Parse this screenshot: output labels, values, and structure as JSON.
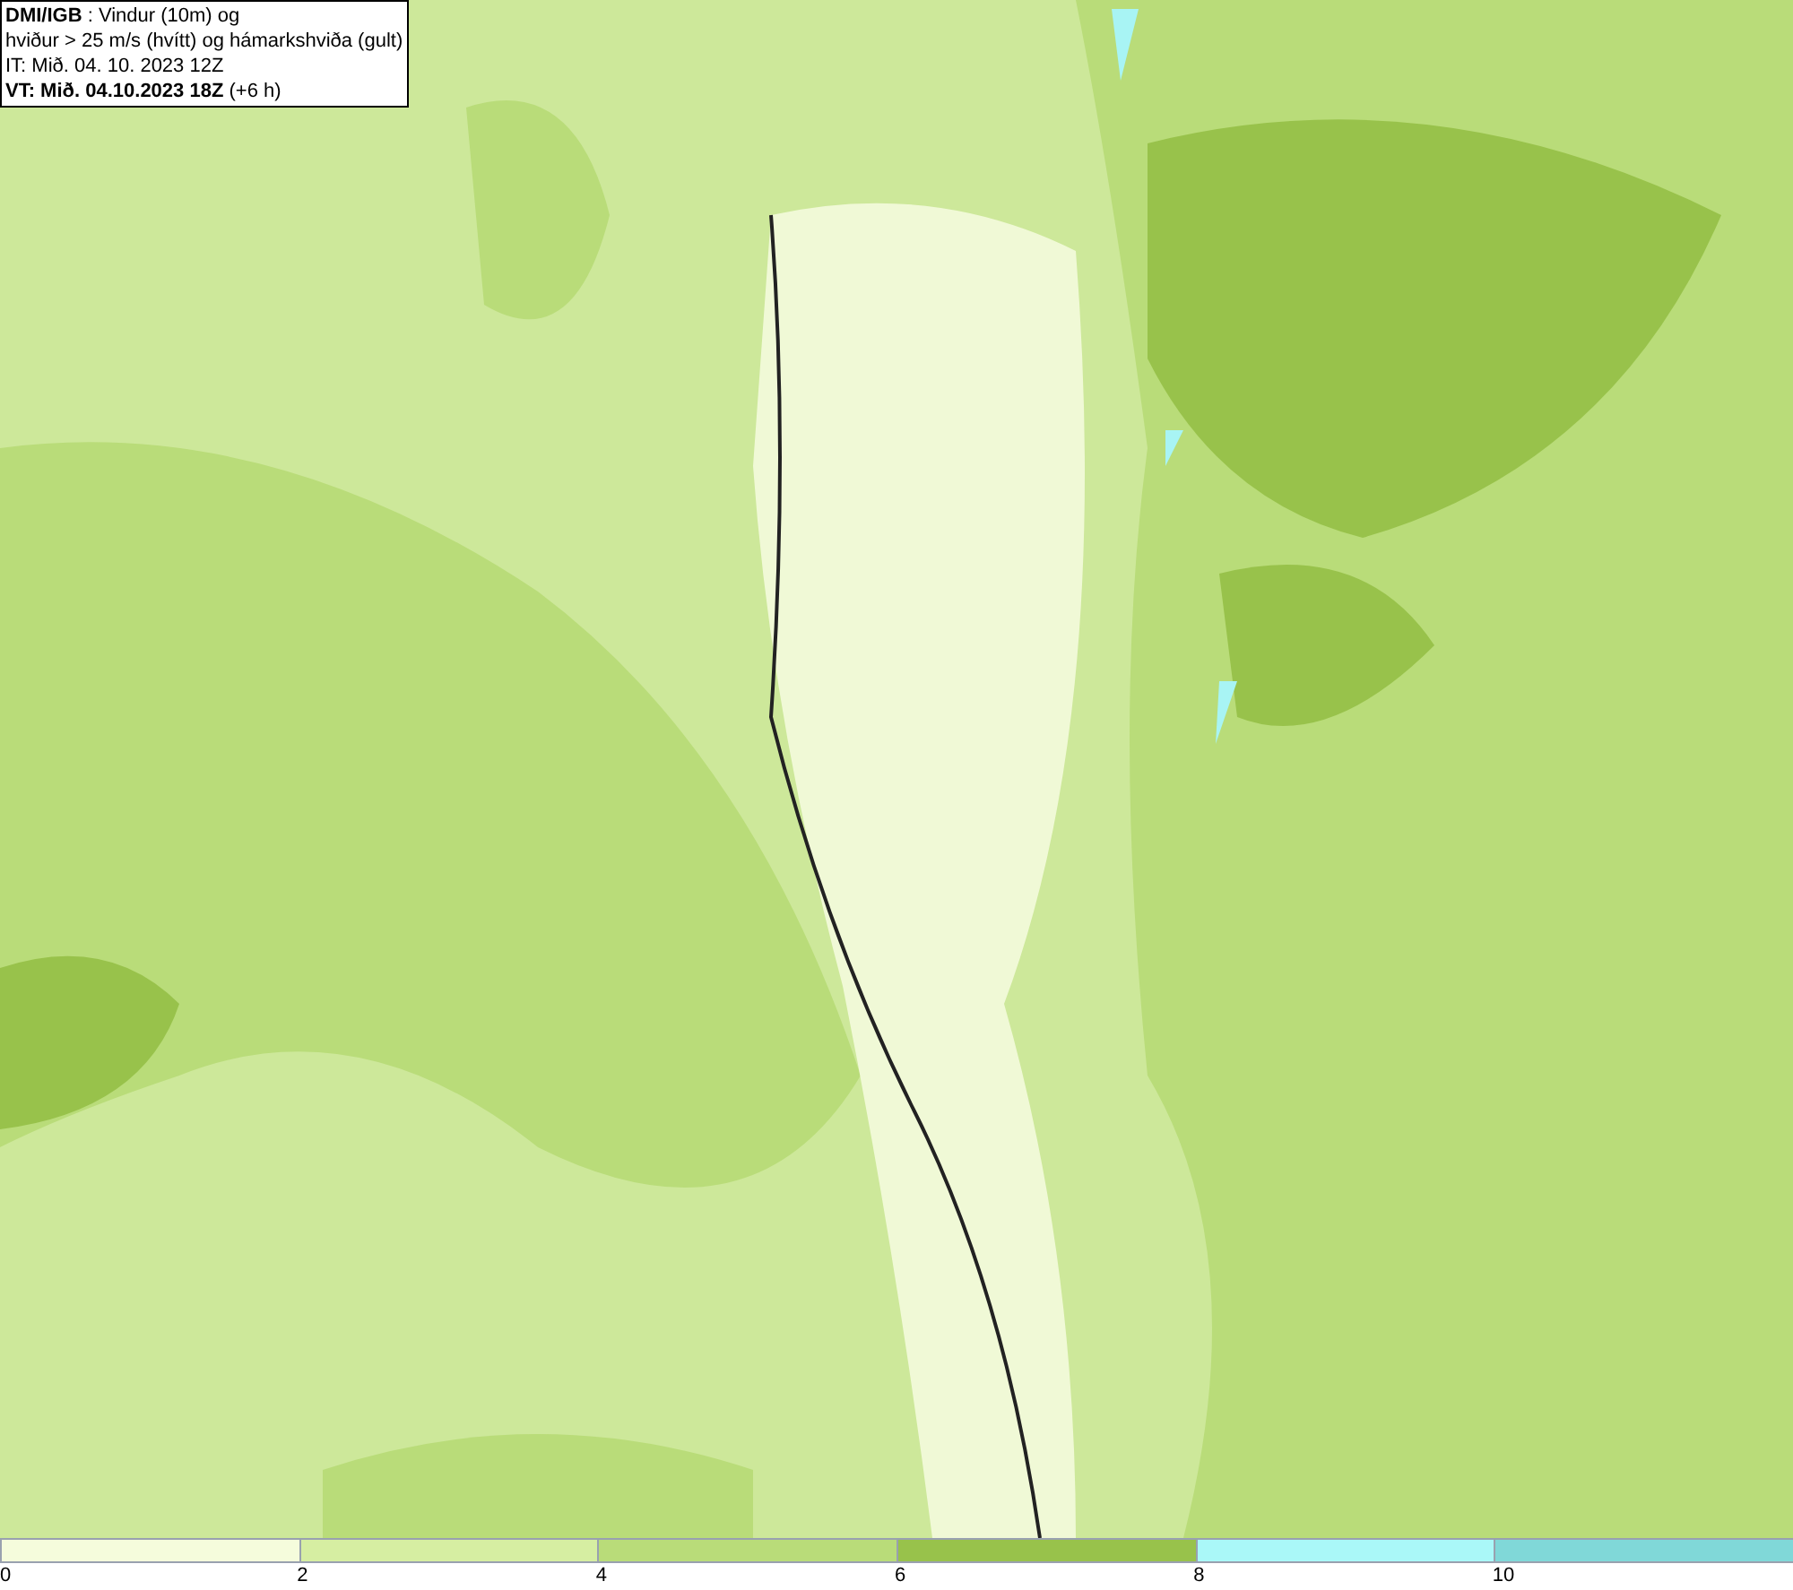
{
  "info_box": {
    "lines": [
      "**DMI/IGB** : Vindur (10m) og",
      "hviður > 25 m/s (hvítt) og hámarkshviða (gult)",
      "IT: Mið. 04. 10. 2023 12Z",
      "**VT: Mið. 04.10.2023 18Z** (+6 h)"
    ]
  },
  "legend": {
    "bands": [
      {
        "label": "0",
        "color": "#f5fcdc"
      },
      {
        "label": "2",
        "color": "#d6eea2"
      },
      {
        "label": "4",
        "color": "#b9dc79"
      },
      {
        "label": "6",
        "color": "#98c24b"
      },
      {
        "label": "8",
        "color": "#aaf8f8"
      },
      {
        "label": "10",
        "color": "#80d8d8"
      }
    ]
  }
}
